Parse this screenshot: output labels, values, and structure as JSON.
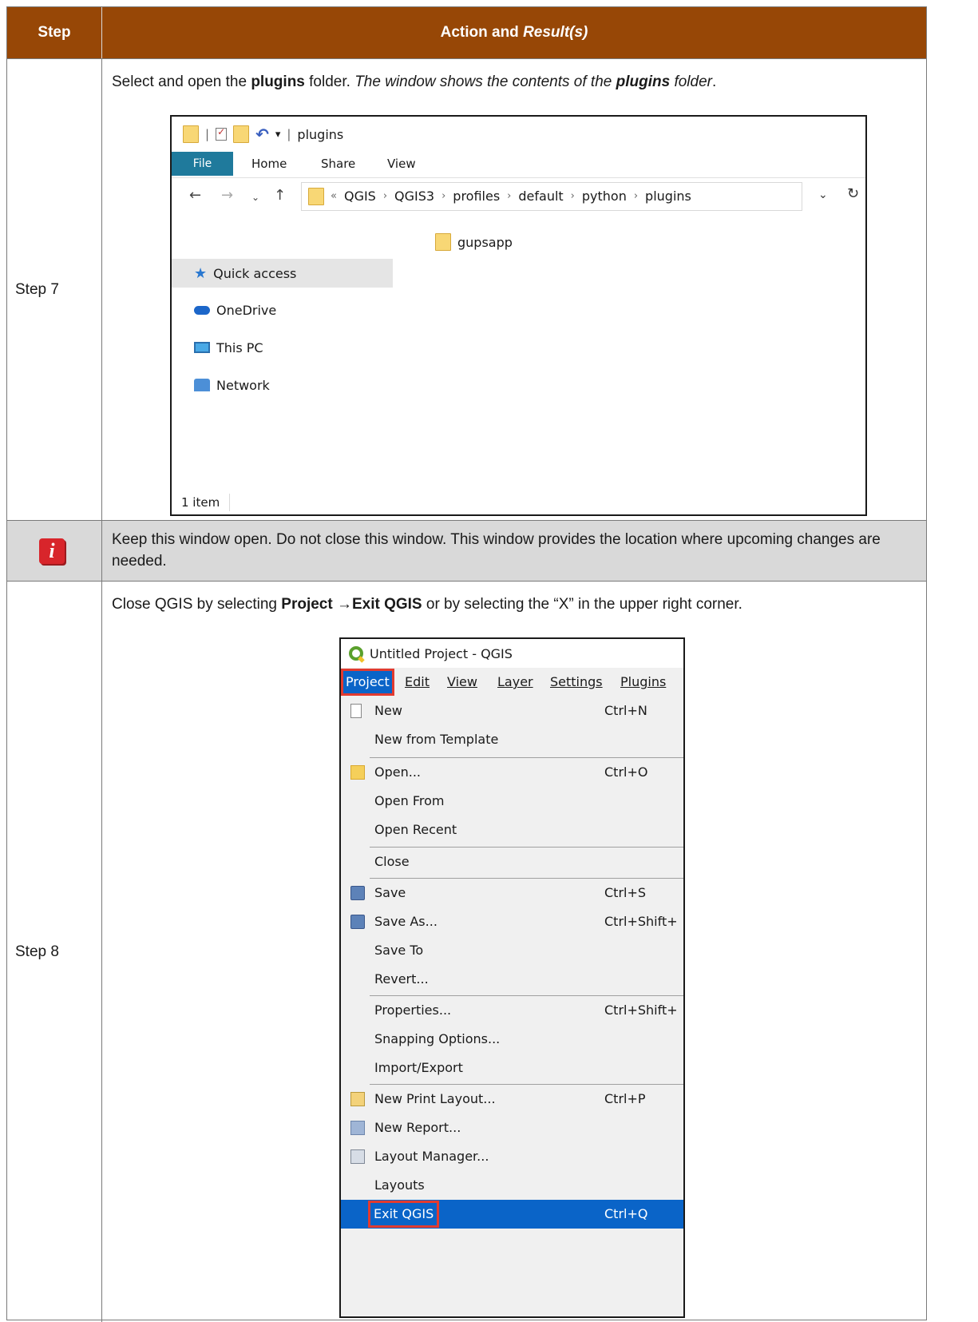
{
  "header": {
    "col_step": "Step",
    "col_action_prefix": "Action and ",
    "col_action_italic": "Result(s)"
  },
  "step7": {
    "label": "Step 7",
    "instruction": {
      "t1": "Select and open the ",
      "b1": "plugins",
      "t2": " folder. ",
      "i1": "The window shows the contents of the ",
      "bi1": "plugins",
      "i2": " folder",
      "t3": "."
    },
    "explorer": {
      "title": "plugins",
      "tabs": [
        "File",
        "Home",
        "Share",
        "View"
      ],
      "breadcrumb": [
        "QGIS",
        "QGIS3",
        "profiles",
        "default",
        "python",
        "plugins"
      ],
      "overflow_glyph": "«",
      "sidebar": [
        "Quick access",
        "OneDrive",
        "This PC",
        "Network"
      ],
      "items": [
        "gupsapp"
      ],
      "status": "1 item"
    }
  },
  "note": {
    "text": "Keep this window open. Do not close this window. This window provides the location where upcoming changes are needed.",
    "icon_letter": "i"
  },
  "step8": {
    "label": "Step 8",
    "instruction": {
      "t1": "Close QGIS by selecting ",
      "b1": "Project ",
      "arrow": "→",
      "b2": "Exit QGIS",
      "t2": " or by selecting the “X” in the upper right corner."
    },
    "qgis": {
      "window_title": "Untitled Project - QGIS",
      "menubar": [
        "Project",
        "Edit",
        "View",
        "Layer",
        "Settings",
        "Plugins"
      ],
      "menu_items": [
        {
          "label": "New",
          "shortcut": "Ctrl+N"
        },
        {
          "label": "New from Template",
          "shortcut": ""
        },
        {
          "label": "Open...",
          "shortcut": "Ctrl+O"
        },
        {
          "label": "Open From",
          "shortcut": ""
        },
        {
          "label": "Open Recent",
          "shortcut": ""
        },
        {
          "label": "Close",
          "shortcut": ""
        },
        {
          "label": "Save",
          "shortcut": "Ctrl+S"
        },
        {
          "label": "Save As...",
          "shortcut": "Ctrl+Shift+"
        },
        {
          "label": "Save To",
          "shortcut": ""
        },
        {
          "label": "Revert...",
          "shortcut": ""
        },
        {
          "label": "Properties...",
          "shortcut": "Ctrl+Shift+"
        },
        {
          "label": "Snapping Options...",
          "shortcut": ""
        },
        {
          "label": "Import/Export",
          "shortcut": ""
        },
        {
          "label": "New Print Layout...",
          "shortcut": "Ctrl+P"
        },
        {
          "label": "New Report...",
          "shortcut": ""
        },
        {
          "label": "Layout Manager...",
          "shortcut": ""
        },
        {
          "label": "Layouts",
          "shortcut": ""
        },
        {
          "label": "Exit QGIS",
          "shortcut": "Ctrl+Q"
        }
      ]
    }
  },
  "colors": {
    "header_bg": "#974706",
    "note_bg": "#d9d9d9",
    "highlight_blue": "#0a64c8",
    "callout_red": "#e23b30"
  }
}
